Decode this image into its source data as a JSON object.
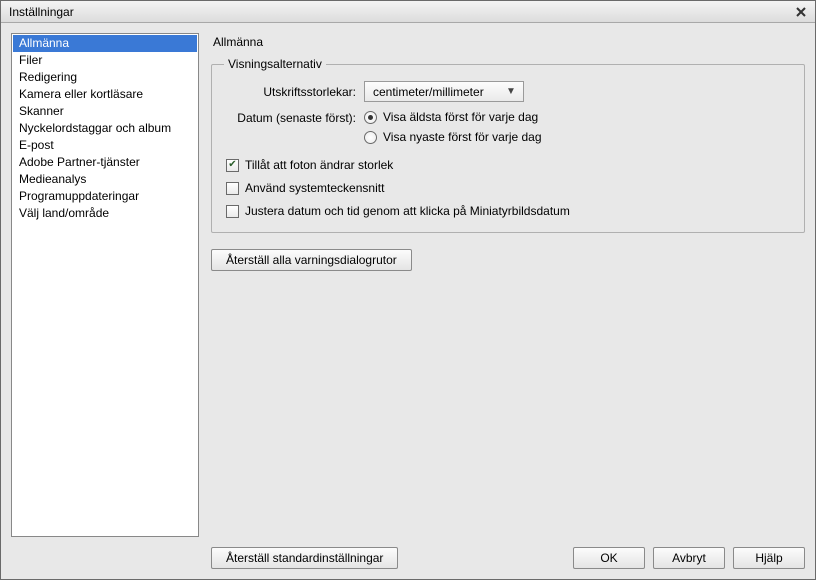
{
  "window": {
    "title": "Inställningar"
  },
  "sidebar": {
    "items": [
      {
        "label": "Allmänna",
        "selected": true
      },
      {
        "label": "Filer"
      },
      {
        "label": "Redigering"
      },
      {
        "label": "Kamera eller kortläsare"
      },
      {
        "label": "Skanner"
      },
      {
        "label": "Nyckelordstaggar och album"
      },
      {
        "label": "E-post"
      },
      {
        "label": "Adobe Partner-tjänster"
      },
      {
        "label": "Medieanalys"
      },
      {
        "label": "Programuppdateringar"
      },
      {
        "label": "Välj land/område"
      }
    ]
  },
  "panel": {
    "title": "Allmänna",
    "group_title": "Visningsalternativ",
    "print_sizes_label": "Utskriftsstorlekar:",
    "print_sizes_value": "centimeter/millimeter",
    "date_label": "Datum (senaste först):",
    "date_option_oldest": "Visa äldsta först för varje dag",
    "date_option_newest": "Visa nyaste först för varje dag",
    "check_resize": "Tillåt att foton ändrar storlek",
    "check_system_fonts": "Använd systemteckensnitt",
    "check_adjust_date": "Justera datum och tid genom att klicka på Miniatyrbildsdatum",
    "reset_warnings_label": "Återställ alla varningsdialogrutor"
  },
  "footer": {
    "restore_defaults": "Återställ standardinställningar",
    "ok": "OK",
    "cancel": "Avbryt",
    "help": "Hjälp"
  }
}
